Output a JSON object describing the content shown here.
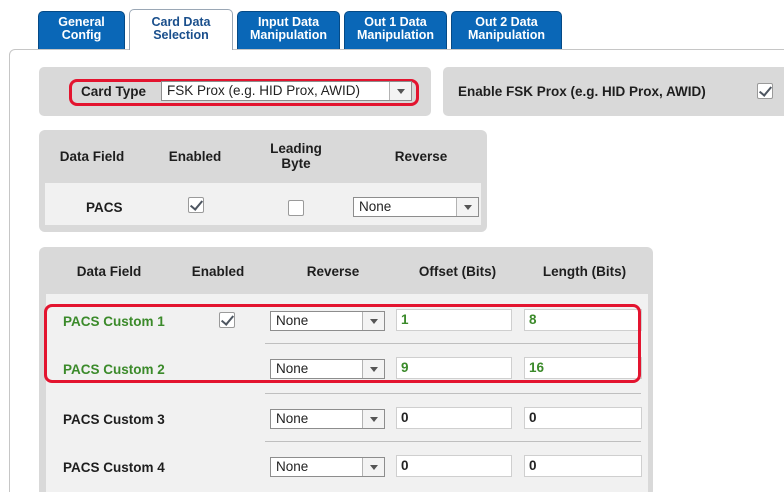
{
  "tabs": [
    {
      "line1": "General",
      "line2": "Config"
    },
    {
      "line1": "Card Data",
      "line2": "Selection"
    },
    {
      "line1": "Input Data",
      "line2": "Manipulation"
    },
    {
      "line1": "Out 1 Data",
      "line2": "Manipulation"
    },
    {
      "line1": "Out 2 Data",
      "line2": "Manipulation"
    }
  ],
  "card_type": {
    "label": "Card Type",
    "value": "FSK Prox (e.g. HID Prox, AWID)"
  },
  "enable": {
    "label": "Enable FSK Prox (e.g. HID Prox, AWID)",
    "checked": true
  },
  "pacs_table": {
    "headers": {
      "data_field": "Data Field",
      "enabled": "Enabled",
      "leading_byte_1": "Leading",
      "leading_byte_2": "Byte",
      "reverse": "Reverse"
    },
    "row": {
      "name": "PACS",
      "enabled": true,
      "leading_byte": false,
      "reverse": "None"
    }
  },
  "custom_table": {
    "headers": {
      "data_field": "Data Field",
      "enabled": "Enabled",
      "reverse": "Reverse",
      "offset": "Offset (Bits)",
      "length": "Length (Bits)"
    },
    "rows": [
      {
        "name": "PACS Custom 1",
        "enabled": true,
        "reverse": "None",
        "offset": "1",
        "length": "8"
      },
      {
        "name": "PACS Custom 2",
        "enabled": null,
        "reverse": "None",
        "offset": "9",
        "length": "16"
      },
      {
        "name": "PACS Custom 3",
        "enabled": null,
        "reverse": "None",
        "offset": "0",
        "length": "0"
      },
      {
        "name": "PACS Custom 4",
        "enabled": null,
        "reverse": "None",
        "offset": "0",
        "length": "0"
      }
    ]
  },
  "colors": {
    "tab_blue": "#0a67b7",
    "highlight_red": "#e3142f",
    "active_green": "#3b8a2a"
  }
}
